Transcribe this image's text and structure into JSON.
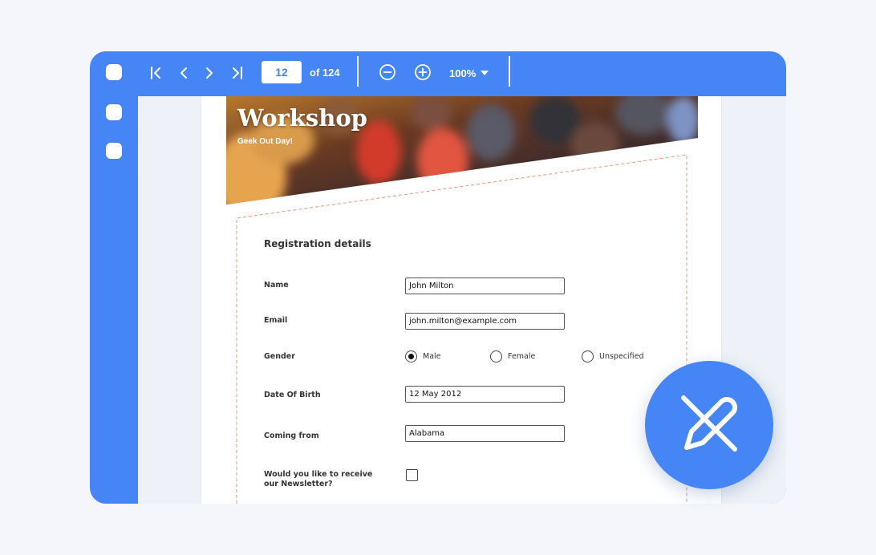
{
  "toolbar": {
    "page_number": "12",
    "page_total_label": "of 124",
    "zoom_level": "100%",
    "icons": [
      "first-page-icon",
      "previous-page-icon",
      "next-page-icon",
      "last-page-icon",
      "zoom-out-icon",
      "zoom-in-icon"
    ]
  },
  "banner": {
    "title": "Workshop",
    "subtitle": "Geek Out Day!"
  },
  "form": {
    "section_title": "Registration details",
    "fields": {
      "name": {
        "label": "Name",
        "value": "John Milton"
      },
      "email": {
        "label": "Email",
        "value": "john.milton@example.com"
      },
      "gender": {
        "label": "Gender",
        "options": [
          "Male",
          "Female",
          "Unspecified"
        ],
        "selected": "Male"
      },
      "dob": {
        "label": "Date Of Birth",
        "value": "12 May 2012"
      },
      "coming_from": {
        "label": "Coming from",
        "value": "Alabama"
      },
      "newsletter": {
        "label": "Would you like to receive our Newsletter?",
        "checked": false
      }
    }
  },
  "badge": {
    "icon": "edit-disabled-icon"
  },
  "colors": {
    "accent": "#4585f5",
    "background": "#f4f6fb",
    "dashed_border": "#e8967a"
  }
}
